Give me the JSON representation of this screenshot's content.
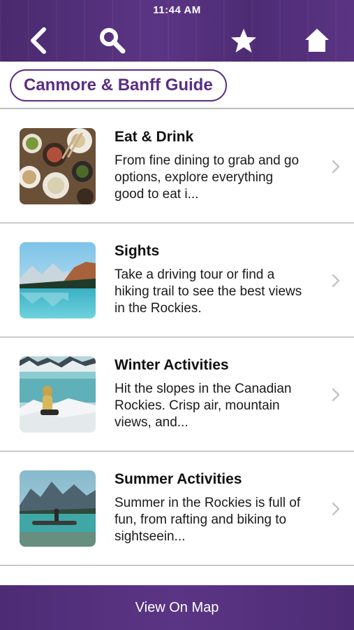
{
  "status": {
    "time": "11:44 AM"
  },
  "nav": {
    "back_icon": "back-chevron-icon",
    "search_icon": "magnifier-icon",
    "favorite_icon": "star-icon",
    "home_icon": "house-icon"
  },
  "header": {
    "title": "Canmore & Banff Guide"
  },
  "items": [
    {
      "title": "Eat & Drink",
      "description": "From fine dining to grab and go options, explore everything good to eat i...",
      "image": "food-table-photo"
    },
    {
      "title": "Sights",
      "description": "Take a driving tour or find a hiking trail to see the best views in the Rockies.",
      "image": "mountain-lake-photo"
    },
    {
      "title": "Winter Activities",
      "description": "Hit the slopes in the Canadian Rockies. Crisp air, mountain views, and...",
      "image": "snowy-mountain-person-photo"
    },
    {
      "title": "Summer Activities",
      "description": "Summer in the Rockies is full of fun, from rafting and biking to sightseein...",
      "image": "canoe-lake-photo"
    }
  ],
  "footer": {
    "map_label": "View On Map"
  },
  "colors": {
    "brand_purple": "#5a2d84",
    "bar_purple": "#4e2c74"
  }
}
